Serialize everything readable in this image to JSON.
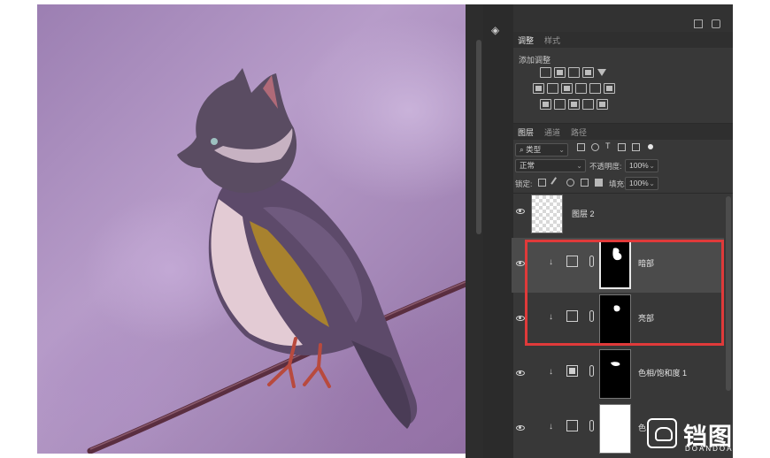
{
  "adjustments_panel": {
    "tabs": [
      "调整",
      "样式"
    ],
    "title": "添加调整"
  },
  "layers_panel": {
    "tabs": [
      "图层",
      "通道",
      "路径"
    ],
    "filter_kind": "类型",
    "blend_mode": "正常",
    "opacity_label": "不透明度:",
    "opacity_value": "100%",
    "lock_label": "锁定:",
    "fill_label": "填充:",
    "fill_value": "100%",
    "layers": [
      {
        "name": "图层 2",
        "type": "pixel"
      },
      {
        "name": "暗部",
        "type": "curves",
        "mask": "black",
        "selected": true
      },
      {
        "name": "亮部",
        "type": "curves",
        "mask": "black",
        "selected": false
      },
      {
        "name": "色相/饱和度 1",
        "type": "hue-saturation",
        "mask": "black"
      },
      {
        "name": "色",
        "type": "color-balance",
        "mask": "white"
      }
    ]
  },
  "annotation": {
    "highlight_color": "#e03a3a"
  },
  "watermark": {
    "logo_text": "铛图",
    "sub_text": "DOANDOA"
  },
  "colors": {
    "panel_bg": "#383838",
    "selected_layer_bg": "#4b4b4b"
  }
}
